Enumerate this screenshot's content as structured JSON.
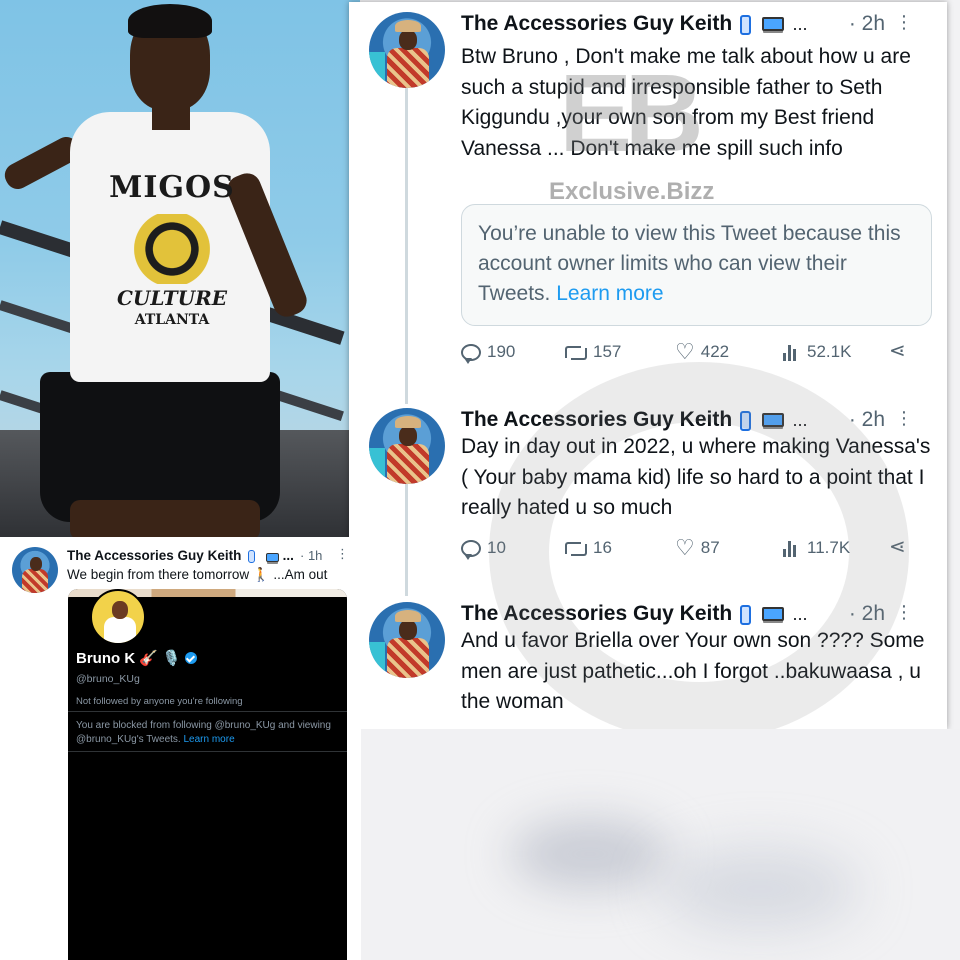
{
  "photo": {
    "shirt_brand": "MIGOS",
    "shirt_line1": "CULTURE",
    "shirt_line2": "ATLANTA"
  },
  "watermark": {
    "logo": "EB",
    "text": "Exclusive.Bizz"
  },
  "tweets": [
    {
      "author": "The Accessories Guy Keith",
      "ellipsis": "...",
      "time": "· 2h",
      "more": "⋮",
      "text": "Btw Bruno , Don't make me talk about how u are such a stupid and irresponsible father to Seth Kiggundu ,your own son from my Best friend Vanessa ... Don't make me spill such info",
      "quote_text": "You’re unable to view this Tweet because this account owner limits who can view their Tweets.",
      "quote_link": "Learn more",
      "replies": "190",
      "retweets": "157",
      "likes": "422",
      "views": "52.1K"
    },
    {
      "author": "The Accessories Guy Keith",
      "ellipsis": "...",
      "time": "· 2h",
      "more": "⋮",
      "text": "Day in day out in 2022, u where making Vanessa's ( Your baby mama kid) life so hard to a point that I really hated u so much",
      "replies": "10",
      "retweets": "16",
      "likes": "87",
      "views": "11.7K"
    },
    {
      "author": "The Accessories Guy Keith",
      "ellipsis": "...",
      "time": "· 2h",
      "more": "⋮",
      "text": "And u favor Briella over Your own son ???? Some men are just pathetic...oh I forgot ..bakuwaasa , u the woman"
    }
  ],
  "small_tweet": {
    "author": "The Accessories Guy Keith",
    "ellipsis": "...",
    "time": "· 1h",
    "more": "⋮",
    "text": "We begin from there tomorrow 🚶 ...Am out",
    "profile": {
      "name": "Bruno K 🎸 🎙️",
      "handle": "@bruno_KUg",
      "follow_note": "Not followed by anyone you're following",
      "blocked_text": "You are blocked from following @bruno_KUg and viewing @bruno_KUg's Tweets.",
      "blocked_link": "Learn more"
    }
  },
  "icons": {
    "reply": "reply-icon",
    "retweet": "retweet-icon",
    "like": "heart-icon",
    "views": "views-icon",
    "share": "share-icon"
  },
  "colors": {
    "link": "#1d9bf0",
    "text": "#0f1419",
    "muted": "#536471"
  }
}
